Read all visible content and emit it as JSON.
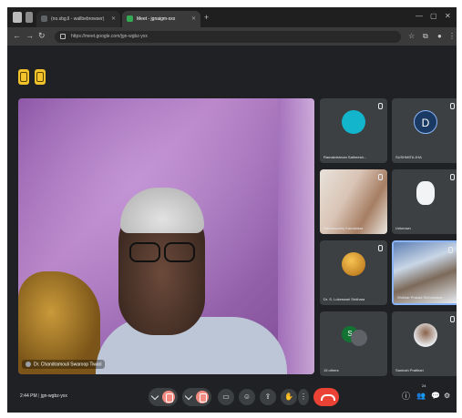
{
  "browser": {
    "tabs": [
      {
        "label": "(no.sbg.ll - wallbebrowser)",
        "favicon_color": "#5f6368",
        "active": false
      },
      {
        "label": "Meet - jgnaigm-xxx",
        "favicon_color": "#34a853",
        "active": true
      }
    ],
    "new_tab_glyph": "+",
    "url": "https://meet.google.com/jgn-wgbz-yxx"
  },
  "meet": {
    "main_participant": {
      "name": "Dr. Chandramouli Swaroop Tiwari"
    },
    "participants": [
      {
        "name": "Ramakrishnan Satheesh...",
        "initial": "",
        "avatar_color": "#12b5cb",
        "kind": "avatar"
      },
      {
        "name": "SUSHMITA JHA",
        "initial": "D",
        "avatar_color": "#1a3a63",
        "kind": "avatar"
      },
      {
        "name": "Ramaswamy Kamalakar",
        "initial": "",
        "avatar_color": "",
        "kind": "video"
      },
      {
        "name": "Unknown",
        "initial": "",
        "avatar_color": "#f1f3f4",
        "kind": "avatar"
      },
      {
        "name": "Dr. S. Lokeswari Sridhara",
        "initial": "",
        "avatar_color": "#d99a2b",
        "kind": "avatar"
      },
      {
        "name": "Shikhar Prasad Shrivastava",
        "initial": "",
        "avatar_color": "",
        "kind": "video"
      },
      {
        "name": "15 others",
        "initial": "S",
        "avatar_color": "#137333",
        "kind": "group"
      },
      {
        "name": "Santosh Pratihari",
        "initial": "",
        "avatar_color": "#e8eaed",
        "kind": "avatar"
      }
    ],
    "meeting_time": "2:44 PM",
    "meeting_code": "jgn-wgbz-yxx",
    "controls": [
      {
        "id": "mic",
        "glyph": "🎤"
      },
      {
        "id": "camera",
        "glyph": "📷"
      },
      {
        "id": "captions",
        "glyph": "▭"
      },
      {
        "id": "emoji",
        "glyph": "☺"
      },
      {
        "id": "present",
        "glyph": "⇪"
      },
      {
        "id": "raise-hand",
        "glyph": "✋"
      },
      {
        "id": "more",
        "glyph": "⋮"
      }
    ],
    "right_icons": [
      {
        "id": "info",
        "glyph": "ⓘ"
      },
      {
        "id": "people",
        "glyph": "👥",
        "badge": "24"
      },
      {
        "id": "chat",
        "glyph": "💬"
      },
      {
        "id": "activities",
        "glyph": "⚙"
      }
    ]
  }
}
